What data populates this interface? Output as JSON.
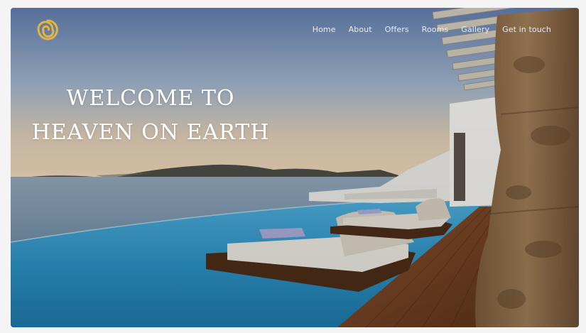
{
  "nav": {
    "items": [
      {
        "label": "Home"
      },
      {
        "label": "About"
      },
      {
        "label": "Offers"
      },
      {
        "label": "Rooms"
      },
      {
        "label": "Gallery"
      },
      {
        "label": "Get in touch"
      }
    ]
  },
  "hero": {
    "title_line1": "WELCOME TO",
    "title_line2": "HEAVEN ON EARTH"
  },
  "logo": {
    "icon": "spiral-sun-icon",
    "color": "#e3b440"
  },
  "colors": {
    "sky_top": "#5d7bab",
    "sky_horizon": "#e6d2b6",
    "pool": "#2a97c4",
    "deck": "#6b3d22",
    "rock": "#8a6a49"
  }
}
